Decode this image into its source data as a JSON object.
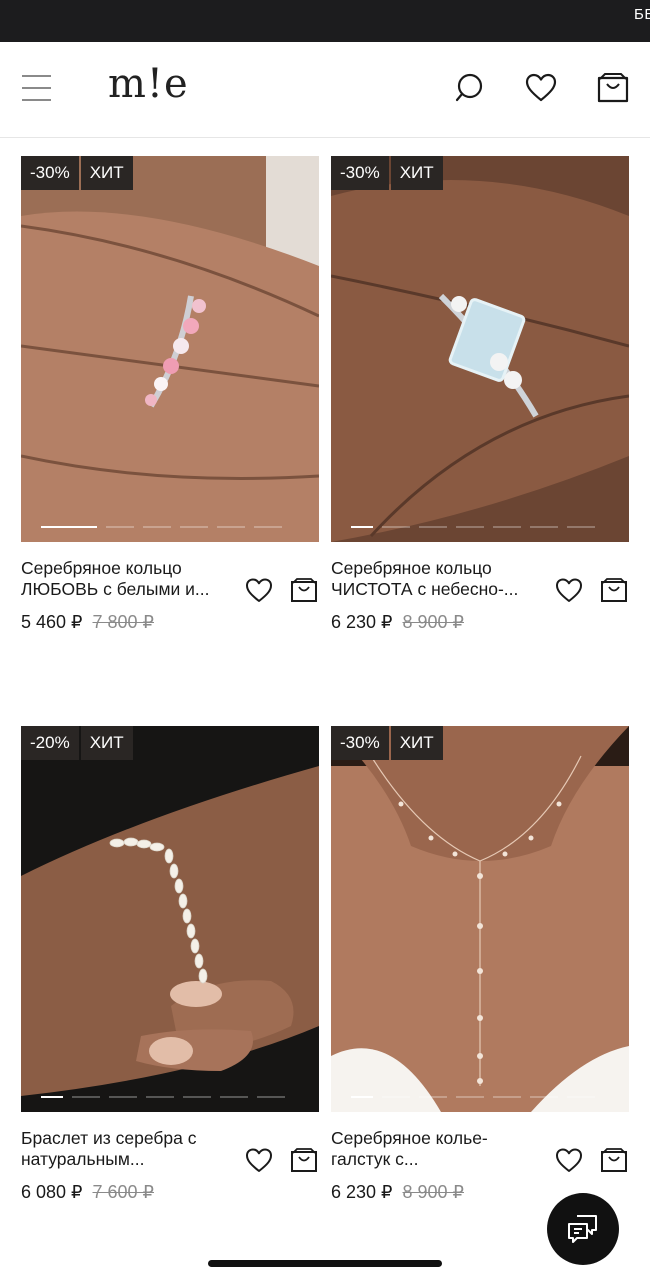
{
  "promo": {
    "text": "БЕ"
  },
  "header": {
    "logo": "m!e",
    "icons": [
      "menu-icon",
      "search-icon",
      "heart-icon",
      "bag-icon"
    ]
  },
  "products": [
    {
      "badges": [
        "-30%",
        "ХИТ"
      ],
      "name_line1": "Серебряное кольцо",
      "name_line2": "ЛЮБОВЬ с белыми и...",
      "price": "5 460 ₽",
      "old_price": "7 800 ₽"
    },
    {
      "badges": [
        "-30%",
        "ХИТ"
      ],
      "name_line1": "Серебряное кольцо",
      "name_line2": "ЧИСТОТА с небесно-...",
      "price": "6 230 ₽",
      "old_price": "8 900 ₽"
    },
    {
      "badges": [
        "-20%",
        "ХИТ"
      ],
      "name_line1": "Браслет из серебра с",
      "name_line2": "натуральным...",
      "price": "6 080 ₽",
      "old_price": "7 600 ₽"
    },
    {
      "badges": [
        "-30%",
        "ХИТ"
      ],
      "name_line1": "Серебряное колье-",
      "name_line2": "галстук с...",
      "price": "6 230 ₽",
      "old_price": "8 900 ₽"
    }
  ],
  "colors": {
    "badge_bg": "#2a2624",
    "text": "#1a1a1a",
    "old_price": "#8a8a8a"
  },
  "chat": {
    "icon": "chat-icon"
  }
}
